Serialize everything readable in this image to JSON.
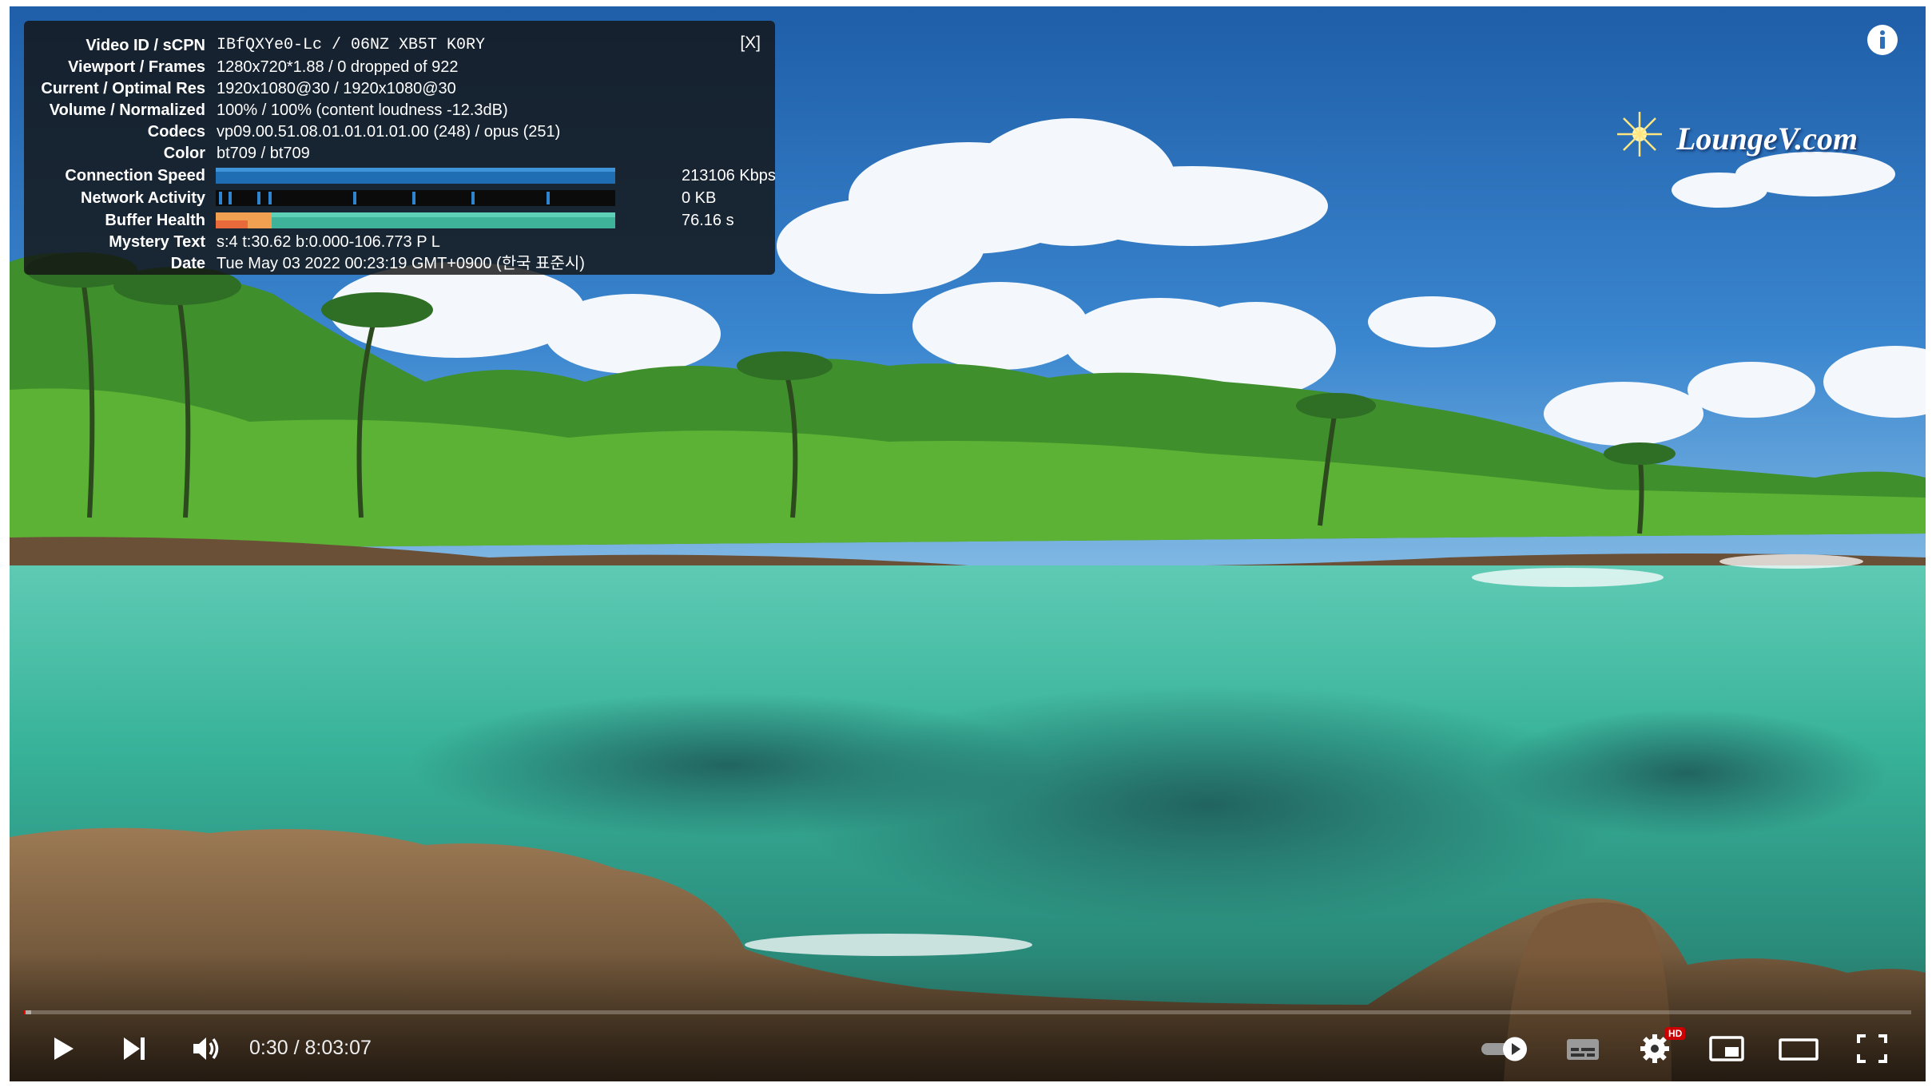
{
  "stats": {
    "close_label": "[X]",
    "rows": [
      {
        "label": "Video ID / sCPN",
        "value": "IBfQXYe0-Lc / 06NZ XB5T K0RY"
      },
      {
        "label": "Viewport / Frames",
        "value": "1280x720*1.88 / 0 dropped of 922"
      },
      {
        "label": "Current / Optimal Res",
        "value": "1920x1080@30 / 1920x1080@30"
      },
      {
        "label": "Volume / Normalized",
        "value": "100% / 100% (content loudness -12.3dB)"
      },
      {
        "label": "Codecs",
        "value": "vp09.00.51.08.01.01.01.01.00 (248) / opus (251)"
      },
      {
        "label": "Color",
        "value": "bt709 / bt709"
      },
      {
        "label": "Connection Speed",
        "value": "213106 Kbps"
      },
      {
        "label": "Network Activity",
        "value": "0 KB"
      },
      {
        "label": "Buffer Health",
        "value": "76.16 s"
      },
      {
        "label": "Mystery Text",
        "value": "s:4 t:30.62 b:0.000-106.773 P L"
      },
      {
        "label": "Date",
        "value": "Tue May 03 2022 00:23:19 GMT+0900 (한국 표준시)"
      }
    ]
  },
  "watermark": {
    "text": "LoungeV.com"
  },
  "controls": {
    "time": "0:30 / 8:03:07",
    "hd_badge": "HD",
    "progress_fraction": 0.001,
    "buffered_fraction": 0.0037
  },
  "colors": {
    "progress_played": "#ff0000",
    "connection_bar": "#1f6db3",
    "buffer_bar": "#3fb39a",
    "buffer_fill": "#f0a050"
  },
  "icons": {
    "info": "info-icon",
    "play": "play-icon",
    "next": "next-icon",
    "volume": "volume-icon",
    "autoplay": "autoplay-toggle-icon",
    "subtitles": "subtitles-icon",
    "settings": "settings-gear-icon",
    "miniplayer": "miniplayer-icon",
    "theater": "theater-mode-icon",
    "fullscreen": "fullscreen-icon"
  }
}
